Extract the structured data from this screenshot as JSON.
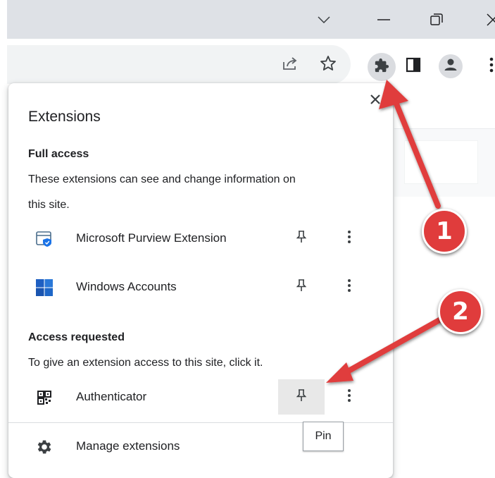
{
  "window": {
    "minimize_icon": "minimize-icon",
    "restore_icon": "restore-icon",
    "close_icon": "close-icon",
    "tabsearch_icon": "chevron-down-icon"
  },
  "toolbar": {
    "icons": [
      "share-icon",
      "bookmark-star-icon",
      "puzzle-icon",
      "side-panel-icon",
      "profile-icon",
      "kebab-menu-icon"
    ]
  },
  "popup": {
    "title": "Extensions",
    "full_access": {
      "heading": "Full access",
      "description_line1": "These extensions can see and change information on",
      "description_line2": "this site.",
      "items": [
        {
          "name": "Microsoft Purview Extension",
          "icon": "purview-shield-icon"
        },
        {
          "name": "Windows Accounts",
          "icon": "windows-logo-icon"
        }
      ]
    },
    "access_requested": {
      "heading": "Access requested",
      "description": "To give an extension access to this site, click it.",
      "items": [
        {
          "name": "Authenticator",
          "icon": "qr-code-icon"
        }
      ]
    },
    "manage_label": "Manage extensions",
    "tooltip": "Pin"
  },
  "annotations": {
    "badge_1": "1",
    "badge_2": "2",
    "color": "#e03c3c"
  }
}
